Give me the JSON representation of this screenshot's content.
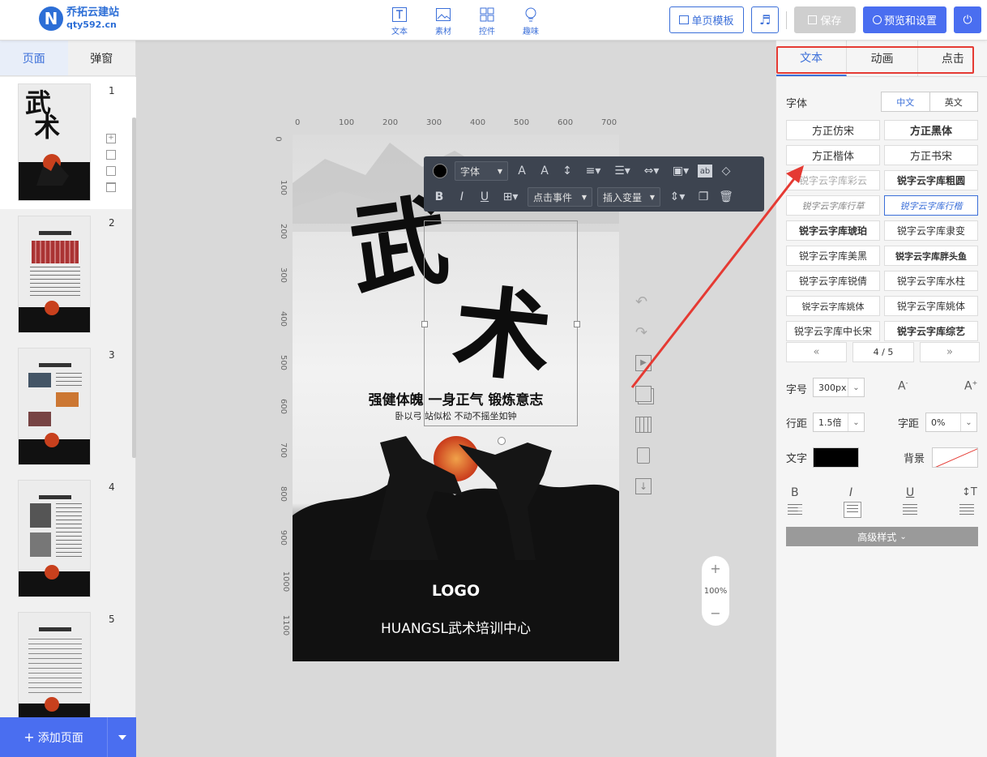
{
  "header": {
    "logo_mark": "N",
    "logo_title": "乔拓云建站",
    "logo_domain": "qty592.cn",
    "tools": [
      {
        "label": "文本",
        "icon": "text-icon"
      },
      {
        "label": "素材",
        "icon": "image-icon"
      },
      {
        "label": "控件",
        "icon": "widget-icon"
      },
      {
        "label": "趣味",
        "icon": "bulb-icon"
      }
    ],
    "template_btn": "单页模板",
    "save_btn": "保存",
    "preview_btn": "预览和设置"
  },
  "left": {
    "tabs": [
      "页面",
      "弹窗"
    ],
    "pages": [
      "1",
      "2",
      "3",
      "4",
      "5"
    ],
    "add_page": "添加页面"
  },
  "ruler": {
    "top": [
      "0",
      "100",
      "200",
      "300",
      "400",
      "500",
      "600",
      "700"
    ],
    "left": [
      "0",
      "100",
      "200",
      "300",
      "400",
      "500",
      "600",
      "700",
      "800",
      "900",
      "1000",
      "1100"
    ]
  },
  "canvas": {
    "title_char1": "武",
    "title_char2": "术",
    "slogan": "强健体魄 一身正气 锻炼意志",
    "sub_slogan": "卧以弓 站似松 不动不摇坐如钟",
    "logo": "LOGO",
    "org_name": "HUANGSL武术培训中心"
  },
  "toolbar": {
    "font_label": "字体",
    "event_label": "点击事件",
    "var_label": "插入变量",
    "ab_label": "ab"
  },
  "zoom": {
    "value": "100%"
  },
  "right": {
    "tabs": [
      "文本",
      "动画",
      "点击"
    ],
    "font_label": "字体",
    "lang": [
      "中文",
      "英文"
    ],
    "fonts": [
      "方正仿宋",
      "方正黑体",
      "方正楷体",
      "方正书宋",
      "锐字云字库彩云",
      "锐字云字库粗圆",
      "锐字云字库行草",
      "锐字云字库行楷",
      "锐字云字库琥珀",
      "锐字云字库隶变",
      "锐字云字库美黑",
      "锐字云字库胖头鱼",
      "锐字云字库锐倩",
      "锐字云字库水柱",
      "锐字云字库姚体",
      "锐字云字库姚体",
      "锐字云字库中长宋",
      "锐字云字库综艺"
    ],
    "pager": {
      "prev": "«",
      "info": "4 / 5",
      "next": "»"
    },
    "size_label": "字号",
    "size_value": "300px",
    "line_label": "行距",
    "line_value": "1.5倍",
    "spacing_label": "字距",
    "spacing_value": "0%",
    "color_label": "文字",
    "bg_label": "背景",
    "text_color": "#000000",
    "advanced": "高级样式"
  }
}
